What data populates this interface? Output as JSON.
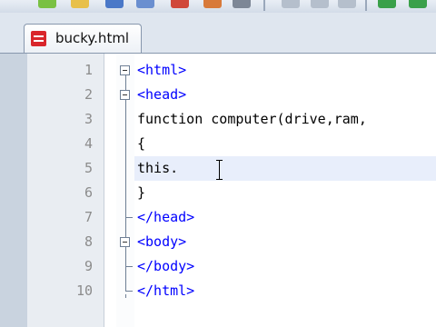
{
  "tab": {
    "filename": "bucky.html"
  },
  "lines": [
    {
      "number": "1",
      "text": "<html>"
    },
    {
      "number": "2",
      "text": "<head>"
    },
    {
      "number": "3",
      "text": "function computer(drive,ram,"
    },
    {
      "number": "4",
      "text": "{"
    },
    {
      "number": "5",
      "text": "this."
    },
    {
      "number": "6",
      "text": "}"
    },
    {
      "number": "7",
      "text": "</head>"
    },
    {
      "number": "8",
      "text": "<body>"
    },
    {
      "number": "9",
      "text": "</body>"
    },
    {
      "number": "10",
      "text": "</html>"
    }
  ],
  "colors": {
    "tag": "#0000ff",
    "text": "#000000",
    "line_number": "#8c8c8c",
    "current_line": "#e8eefb"
  }
}
